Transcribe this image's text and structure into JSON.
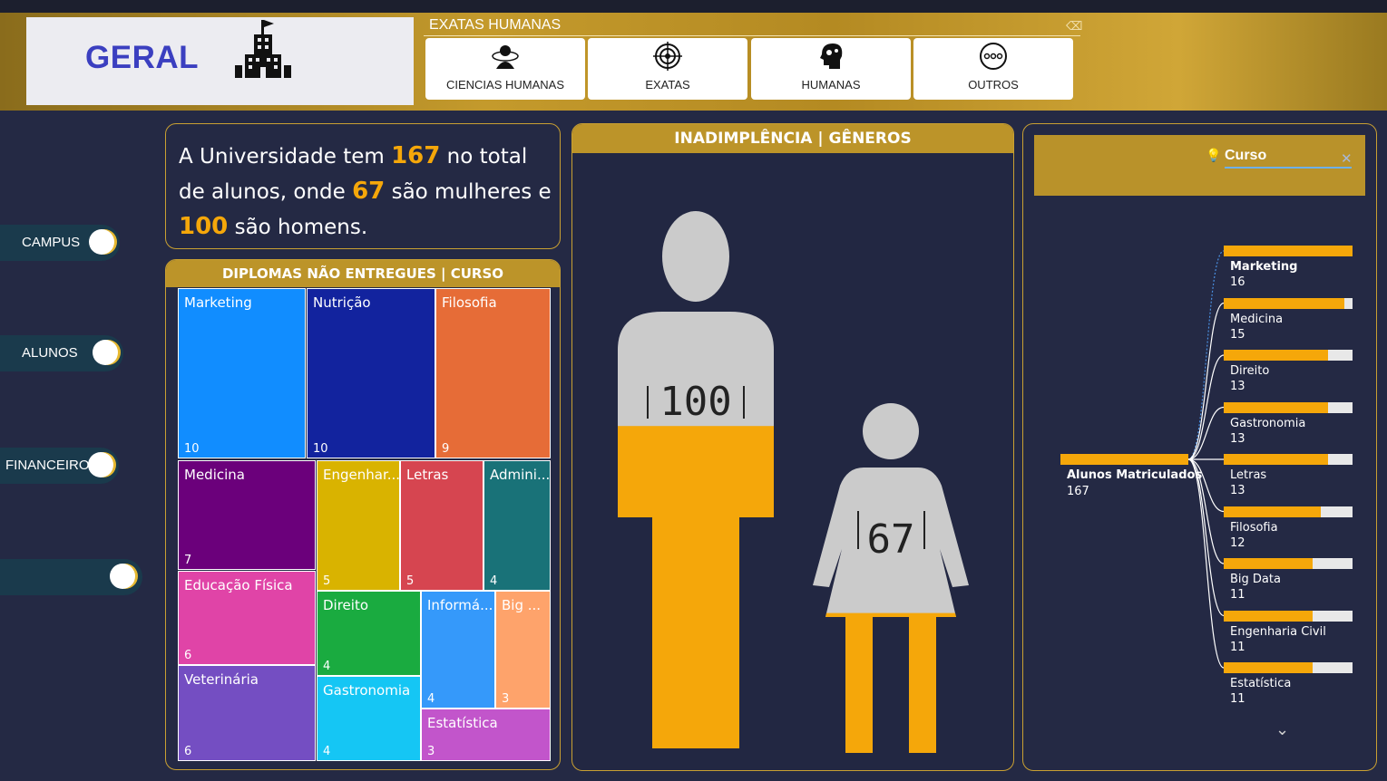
{
  "header": {
    "title": "GERAL",
    "segment_header": "EXATAS HUMANAS",
    "segments": [
      {
        "label": "CIENCIAS HUMANAS",
        "icon": "person-atom-icon"
      },
      {
        "label": "EXATAS",
        "icon": "target-icon"
      },
      {
        "label": "HUMANAS",
        "icon": "head-gears-icon"
      },
      {
        "label": "OUTROS",
        "icon": "more-dots-icon"
      }
    ]
  },
  "nav": {
    "items": [
      {
        "label": "CAMPUS"
      },
      {
        "label": "ALUNOS"
      },
      {
        "label": "FINANCEIRO"
      },
      {
        "label": ""
      }
    ]
  },
  "summary": {
    "t1": "A Universidade tem ",
    "total": "167",
    "t2": " no total de alunos, onde ",
    "women": "67",
    "t3": " são mulheres e ",
    "men": "100",
    "t4": " são homens."
  },
  "treemap": {
    "title": "DIPLOMAS NÃO ENTREGUES | CURSO",
    "cells": [
      {
        "name": "Marketing",
        "value": "10",
        "color": "#118dff"
      },
      {
        "name": "Nutrição",
        "value": "10",
        "color": "#12239e"
      },
      {
        "name": "Filosofia",
        "value": "9",
        "color": "#e66c37"
      },
      {
        "name": "Medicina",
        "value": "7",
        "color": "#6b007b"
      },
      {
        "name": "Engenhar...",
        "value": "5",
        "color": "#d9b300"
      },
      {
        "name": "Letras",
        "value": "5",
        "color": "#d64550"
      },
      {
        "name": "Admini...",
        "value": "4",
        "color": "#197278"
      },
      {
        "name": "Educação Física",
        "value": "6",
        "color": "#e044a7"
      },
      {
        "name": "Direito",
        "value": "4",
        "color": "#1aab40"
      },
      {
        "name": "Informá...",
        "value": "4",
        "color": "#3599fa"
      },
      {
        "name": "Big ...",
        "value": "3",
        "color": "#fea36b"
      },
      {
        "name": "Veterinária",
        "value": "6",
        "color": "#744ec2"
      },
      {
        "name": "Gastronomia",
        "value": "4",
        "color": "#15c6f4"
      },
      {
        "name": "Estatística",
        "value": "3",
        "color": "#c255cb"
      }
    ]
  },
  "gender": {
    "title": "INADIMPLÊNCIA | GÊNEROS",
    "men_value": "100",
    "women_value": "67",
    "men_fill": 0.6,
    "women_fill": 0.4
  },
  "curso": {
    "title": "Curso",
    "root_label": "Alunos Matriculados",
    "root_value": "167",
    "items": [
      {
        "name": "Marketing",
        "value": "16",
        "fill": 1.0
      },
      {
        "name": "Medicina",
        "value": "15",
        "fill": 0.94
      },
      {
        "name": "Direito",
        "value": "13",
        "fill": 0.81
      },
      {
        "name": "Gastronomia",
        "value": "13",
        "fill": 0.81
      },
      {
        "name": "Letras",
        "value": "13",
        "fill": 0.81
      },
      {
        "name": "Filosofia",
        "value": "12",
        "fill": 0.75
      },
      {
        "name": "Big Data",
        "value": "11",
        "fill": 0.69
      },
      {
        "name": "Engenharia Civil",
        "value": "11",
        "fill": 0.69
      },
      {
        "name": "Estatística",
        "value": "11",
        "fill": 0.69
      }
    ]
  },
  "colors": {
    "accent": "#f5a70a",
    "gold": "#c9a032",
    "background": "#242944"
  }
}
